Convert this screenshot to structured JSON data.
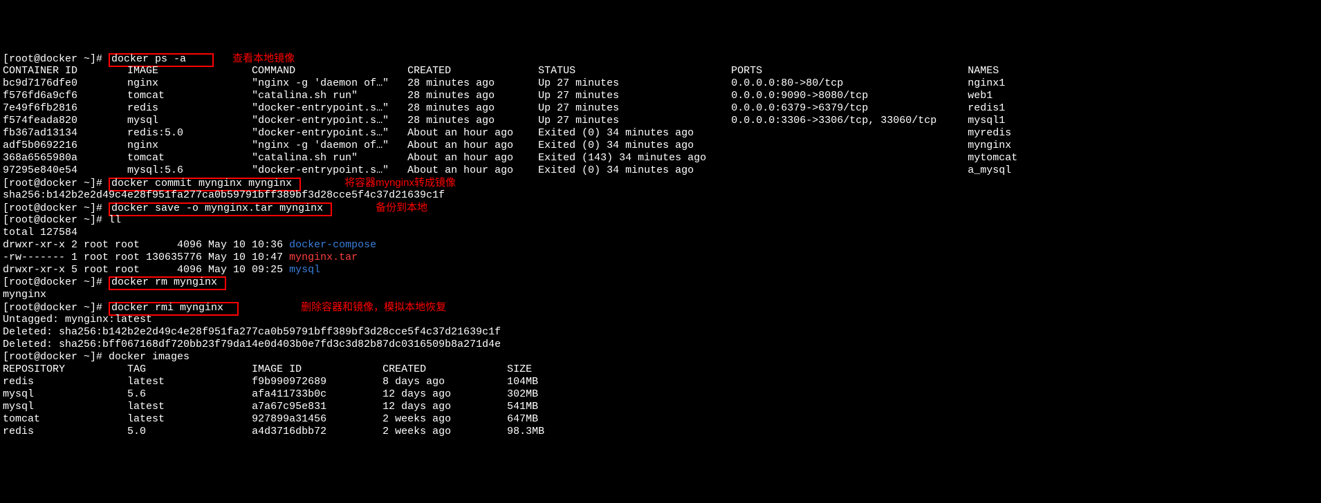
{
  "prompt": "[root@docker ~]# ",
  "commands": {
    "ps": "docker ps -a",
    "commit": "docker commit mynginx mynginx",
    "save": "docker save -o mynginx.tar mynginx",
    "ll": "ll",
    "rm": "docker rm mynginx",
    "rmi": "docker rmi mynginx",
    "images": "docker images"
  },
  "annotations": {
    "ps": "查看本地镜像",
    "commit": "将容器mynginx转成镜像",
    "save": "备份到本地",
    "rm_rmi": "删除容器和镜像，模拟本地恢复"
  },
  "ps_header": {
    "id": "CONTAINER ID",
    "image": "IMAGE",
    "command": "COMMAND",
    "created": "CREATED",
    "status": "STATUS",
    "ports": "PORTS",
    "names": "NAMES"
  },
  "ps_rows": [
    {
      "id": "bc9d7176dfe0",
      "image": "nginx",
      "command": "\"nginx -g 'daemon of…\"",
      "created": "28 minutes ago",
      "status": "Up 27 minutes",
      "ports": "0.0.0.0:80->80/tcp",
      "names": "nginx1"
    },
    {
      "id": "f576fd6a9cf6",
      "image": "tomcat",
      "command": "\"catalina.sh run\"",
      "created": "28 minutes ago",
      "status": "Up 27 minutes",
      "ports": "0.0.0.0:9090->8080/tcp",
      "names": "web1"
    },
    {
      "id": "7e49f6fb2816",
      "image": "redis",
      "command": "\"docker-entrypoint.s…\"",
      "created": "28 minutes ago",
      "status": "Up 27 minutes",
      "ports": "0.0.0.0:6379->6379/tcp",
      "names": "redis1"
    },
    {
      "id": "f574feada820",
      "image": "mysql",
      "command": "\"docker-entrypoint.s…\"",
      "created": "28 minutes ago",
      "status": "Up 27 minutes",
      "ports": "0.0.0.0:3306->3306/tcp, 33060/tcp",
      "names": "mysql1"
    },
    {
      "id": "fb367ad13134",
      "image": "redis:5.0",
      "command": "\"docker-entrypoint.s…\"",
      "created": "About an hour ago",
      "status": "Exited (0) 34 minutes ago",
      "ports": "",
      "names": "myredis"
    },
    {
      "id": "adf5b0692216",
      "image": "nginx",
      "command": "\"nginx -g 'daemon of…\"",
      "created": "About an hour ago",
      "status": "Exited (0) 34 minutes ago",
      "ports": "",
      "names": "mynginx"
    },
    {
      "id": "368a6565980a",
      "image": "tomcat",
      "command": "\"catalina.sh run\"",
      "created": "About an hour ago",
      "status": "Exited (143) 34 minutes ago",
      "ports": "",
      "names": "mytomcat"
    },
    {
      "id": "97295e840e54",
      "image": "mysql:5.6",
      "command": "\"docker-entrypoint.s…\"",
      "created": "About an hour ago",
      "status": "Exited (0) 34 minutes ago",
      "ports": "",
      "names": "a_mysql"
    }
  ],
  "commit_output": "sha256:b142b2e2d49c4e28f951fa277ca0b59791bff389bf3d28cce5f4c37d21639c1f",
  "ll_total": "total 127584",
  "ll_rows": [
    {
      "perm": "drwxr-xr-x",
      "links": "2",
      "owner": "root",
      "group": "root",
      "size": "4096",
      "date": "May 10 10:36",
      "name": "docker-compose",
      "cls": "blue"
    },
    {
      "perm": "-rw-------",
      "links": "1",
      "owner": "root",
      "group": "root",
      "size": "130635776",
      "date": "May 10 10:47",
      "name": "mynginx.tar",
      "cls": "redtxt"
    },
    {
      "perm": "drwxr-xr-x",
      "links": "5",
      "owner": "root",
      "group": "root",
      "size": "4096",
      "date": "May 10 09:25",
      "name": "mysql",
      "cls": "blue"
    }
  ],
  "rm_output": "mynginx",
  "rmi_output": [
    "Untagged: mynginx:latest",
    "Deleted: sha256:b142b2e2d49c4e28f951fa277ca0b59791bff389bf3d28cce5f4c37d21639c1f",
    "Deleted: sha256:bff067168df720bb23f79da14e0d403b0e7fd3c3d82b87dc0316509b8a271d4e"
  ],
  "images_header": {
    "repo": "REPOSITORY",
    "tag": "TAG",
    "id": "IMAGE ID",
    "created": "CREATED",
    "size": "SIZE"
  },
  "images_rows": [
    {
      "repo": "redis",
      "tag": "latest",
      "id": "f9b990972689",
      "created": "8 days ago",
      "size": "104MB"
    },
    {
      "repo": "mysql",
      "tag": "5.6",
      "id": "afa411733b0c",
      "created": "12 days ago",
      "size": "302MB"
    },
    {
      "repo": "mysql",
      "tag": "latest",
      "id": "a7a67c95e831",
      "created": "12 days ago",
      "size": "541MB"
    },
    {
      "repo": "tomcat",
      "tag": "latest",
      "id": "927899a31456",
      "created": "2 weeks ago",
      "size": "647MB"
    },
    {
      "repo": "redis",
      "tag": "5.0",
      "id": "a4d3716dbb72",
      "created": "2 weeks ago",
      "size": "98.3MB"
    }
  ]
}
